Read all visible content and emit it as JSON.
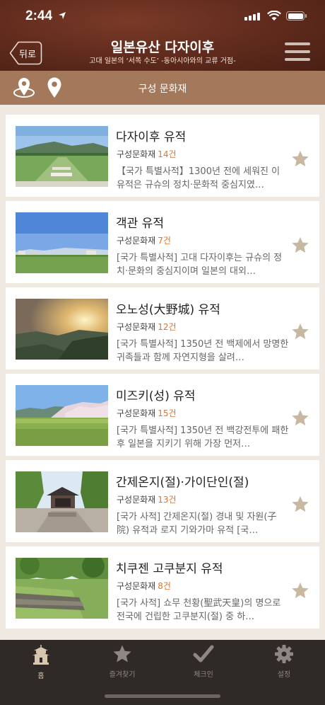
{
  "status_bar": {
    "time": "2:44"
  },
  "header": {
    "back_label": "뒤로",
    "title": "일본유산 다자이후",
    "subtitle": "고대 일본의 ‘서쪽 수도’ -동아시아와의 교류 거점-"
  },
  "subbar": {
    "title": "구성 문화재"
  },
  "list": {
    "items": [
      {
        "title": "다자이후 유적",
        "meta_label": "구성문화재",
        "count": "14건",
        "desc": "【국가 특별사적】1300년 전에 세워진 이 유적은 규슈의 정치·문화적 중심지였…"
      },
      {
        "title": "객관 유적",
        "meta_label": "구성문화재",
        "count": "7건",
        "desc": "[국가 특별사적] 고대 다자이후는 규슈의 정치·문화의 중심지이며 일본의 대외…"
      },
      {
        "title": "오노성(大野城) 유적",
        "meta_label": "구성문화재",
        "count": "12건",
        "desc": "[국가 특별사적] 1350년 전 백제에서 망명한 귀족들과 함께 자연지형을 살려…"
      },
      {
        "title": "미즈키(성) 유적",
        "meta_label": "구성문화재",
        "count": "15건",
        "desc": "[국가 특별사적] 1350년 전 백강전투에 패한 후 일본을 지키기 위해 가장 먼저…"
      },
      {
        "title": "간제온지(절)·가이단인(절)",
        "meta_label": "구성문화재",
        "count": "13건",
        "desc": "[국가 사적] 간제온지(절) 경내 및 자원(子院) 유적과 로지 기와가마 유적 [국…"
      },
      {
        "title": "치쿠젠 고쿠분지 유적",
        "meta_label": "구성문화재",
        "count": "8건",
        "desc": "[국가 사적] 쇼무 천황(聖武天皇)의 명으로 전국에 건립한 고쿠분지(절) 중 하…"
      }
    ]
  },
  "tabbar": {
    "tabs": [
      {
        "label": "홈",
        "icon": "home-pagoda-icon"
      },
      {
        "label": "즐겨찾기",
        "icon": "star-icon"
      },
      {
        "label": "체크인",
        "icon": "checkmark-icon"
      },
      {
        "label": "설정",
        "icon": "gear-icon"
      }
    ]
  },
  "colors": {
    "header": "#5e2a1c",
    "subbar": "#a4785a",
    "accent_count": "#e0732c",
    "star": "#c9b8a1",
    "tabbar": "#2f2a28"
  }
}
